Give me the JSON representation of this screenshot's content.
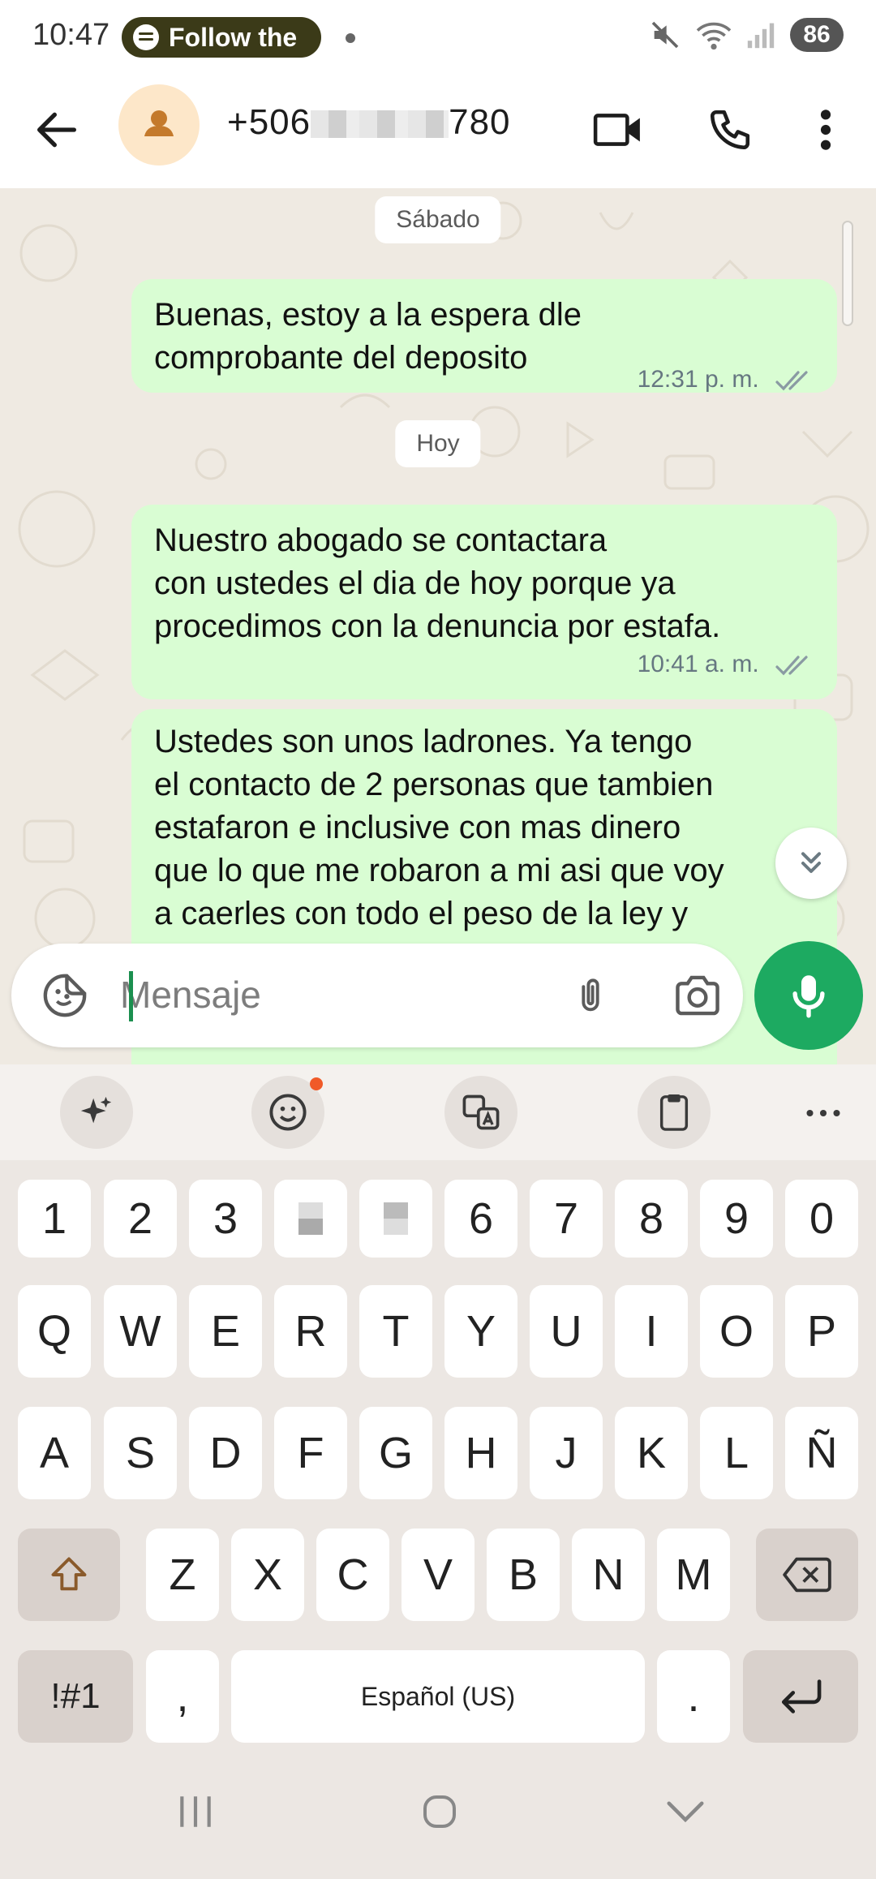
{
  "status_bar": {
    "time": "10:47",
    "media_pill": "Follow the",
    "battery": "86"
  },
  "header": {
    "contact_prefix": "+506",
    "contact_suffix": "780"
  },
  "chat": {
    "date_sat": "Sábado",
    "date_today": "Hoy",
    "messages": [
      {
        "text": "Buenas, estoy a la espera dle\ncomprobante del deposito",
        "time": "12:31 p. m."
      },
      {
        "text": "Nuestro abogado se contactara\ncon ustedes el dia de hoy porque ya\nprocedimos con la denuncia por estafa.",
        "time": "10:41 a. m."
      },
      {
        "text": "Ustedes son unos ladrones. Ya tengo\nel contacto de 2 personas que tambien\nestafaron e inclusive con mas dinero\nque lo que me robaron a mi asi que voy\na caerles con todo el peso de la ley y",
        "time": ""
      }
    ]
  },
  "composer": {
    "placeholder": "Mensaje"
  },
  "keyboard": {
    "row_numbers": [
      "1",
      "2",
      "3",
      "",
      "",
      "6",
      "7",
      "8",
      "9",
      "0"
    ],
    "row_q": [
      "Q",
      "W",
      "E",
      "R",
      "T",
      "Y",
      "U",
      "I",
      "O",
      "P"
    ],
    "row_a": [
      "A",
      "S",
      "D",
      "F",
      "G",
      "H",
      "J",
      "K",
      "L",
      "Ñ"
    ],
    "row_z": [
      "Z",
      "X",
      "C",
      "V",
      "B",
      "N",
      "M"
    ],
    "symbols": "!#1",
    "comma": ",",
    "space": "Español (US)",
    "period": "."
  },
  "colors": {
    "bubble_out": "#d9fdd3",
    "accent": "#1daa61",
    "chat_bg": "#efeae2"
  }
}
